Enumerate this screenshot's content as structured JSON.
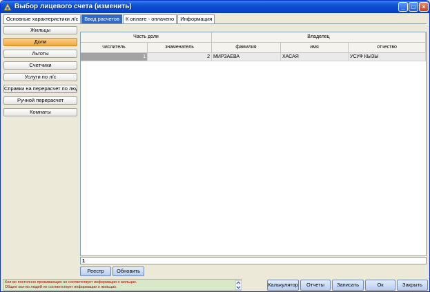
{
  "window": {
    "title": "Выбор лицевого счета (изменить)",
    "title_color": "#0a49d0"
  },
  "tabs": [
    {
      "label": "Основные характеристики л/с",
      "active": false
    },
    {
      "label": "Ввод расчетов",
      "active": true
    },
    {
      "label": "К оплате - оплачено",
      "active": false
    },
    {
      "label": "Информация",
      "active": false
    }
  ],
  "sidebar": {
    "items": [
      {
        "label": "Жильцы",
        "active": false
      },
      {
        "label": "Доли",
        "active": true
      },
      {
        "label": "Льготы",
        "active": false
      },
      {
        "label": "Счетчики",
        "active": false
      },
      {
        "label": "Услуги по л/с",
        "active": false
      },
      {
        "label": "Справки на перерасчет по людям",
        "active": false
      },
      {
        "label": "Ручной перерасчет",
        "active": false
      },
      {
        "label": "Комнаты",
        "active": false
      }
    ],
    "active_color": "#f4a73d"
  },
  "grid": {
    "group_headers": [
      "Часть доли",
      "Владелец"
    ],
    "columns": [
      "числитель",
      "знаменатель",
      "фамилия",
      "имя",
      "отчество"
    ],
    "rows": [
      {
        "numerator": "1",
        "denominator": "2",
        "surname": "МИРЗАЕВА",
        "name": "ХАСАЯ",
        "patronymic": "УСУФ КЫЗЫ"
      }
    ]
  },
  "record_counter": "1",
  "buttons": {
    "registry": "Реестр",
    "refresh": "Обновить",
    "calculator": "Калькулятор",
    "reports": "Отчеты",
    "save": "Записать",
    "ok": "Ок",
    "close": "Закрыть"
  },
  "status": {
    "line1": "Кол-во постоянно проживающих не соответствует информации о жильцах.",
    "line2": "Общее кол-во людей не соответствует информации о жильцах.",
    "text_color": "#b00000"
  },
  "icons": {
    "app": "app-icon",
    "minimize": "minimize-icon",
    "maximize": "maximize-icon",
    "close": "close-icon",
    "scroll": "scroll-arrows-icon"
  }
}
